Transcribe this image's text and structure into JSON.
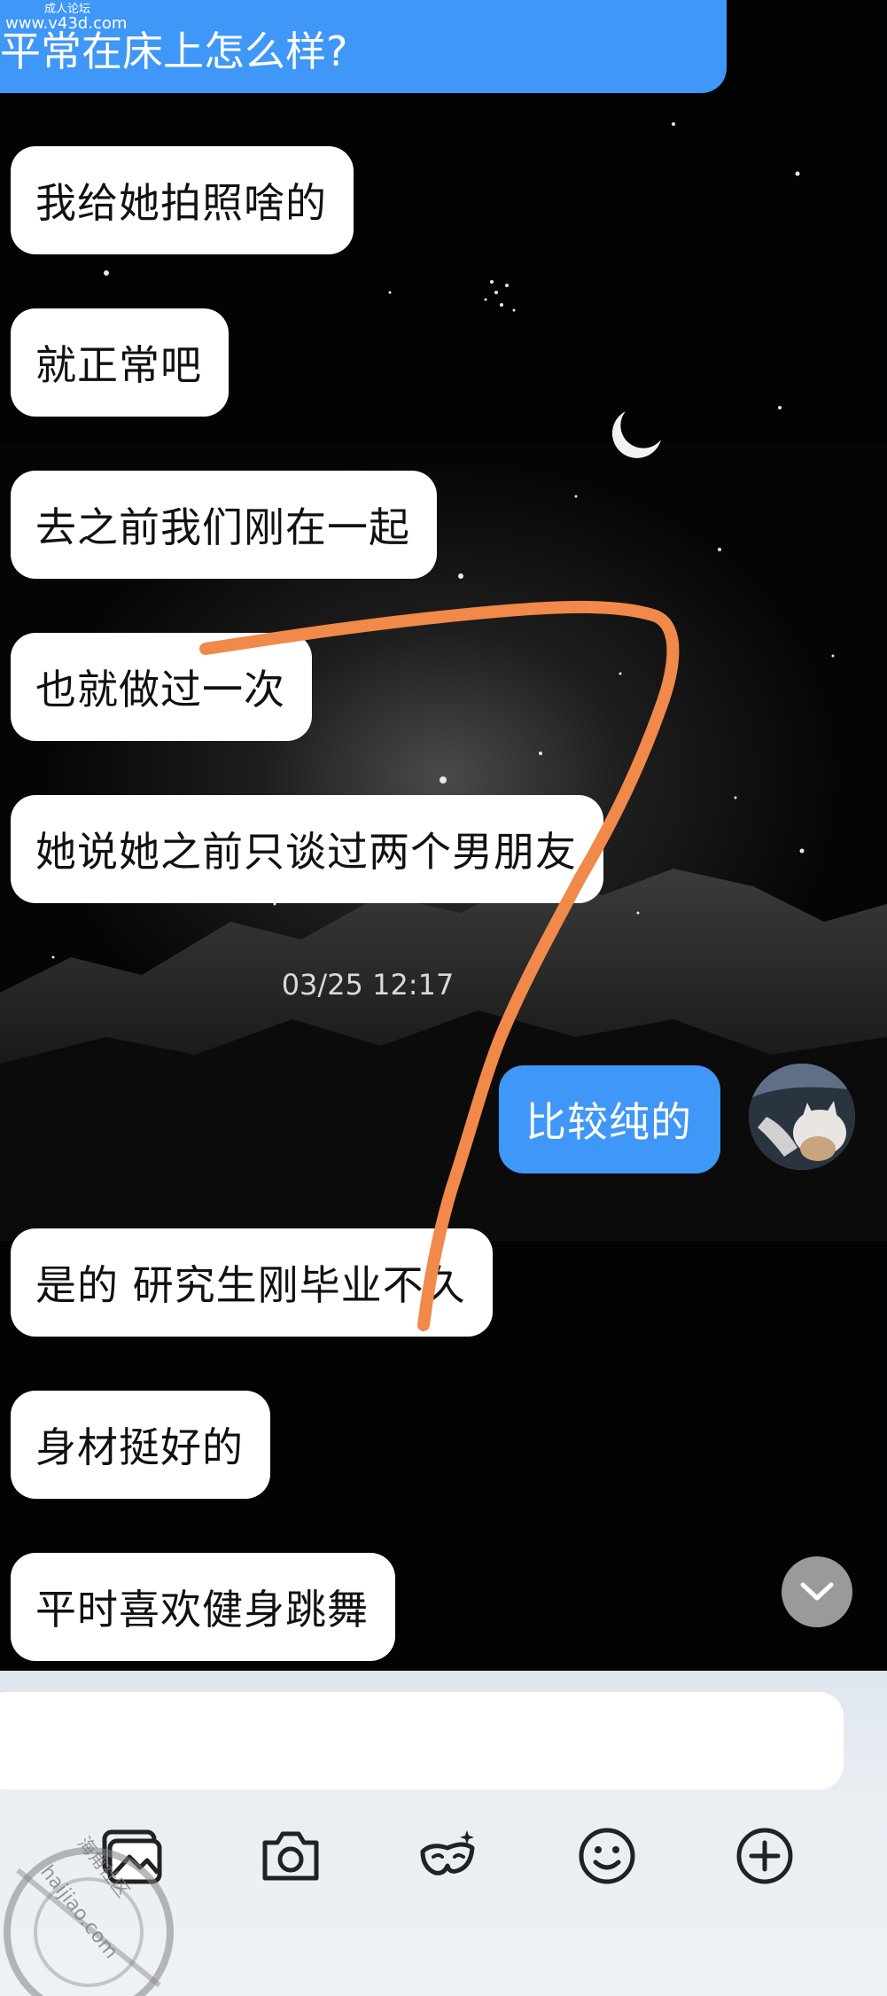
{
  "watermark": {
    "site_cn": "成人论坛",
    "site_url": "www.v43d.com",
    "seal_text": "海角社区",
    "seal_url": "haijiao.com"
  },
  "chat": {
    "top_message": "平常在床上怎么样?",
    "messages_before": [
      "我给她拍照啥的",
      "就正常吧",
      "去之前我们刚在一起",
      "也就做过一次",
      "她说她之前只谈过两个男朋友"
    ],
    "timestamp": "03/25 12:17",
    "outgoing_message": "比较纯的",
    "messages_after": [
      "是的 研究生刚毕业不久",
      "身材挺好的",
      "平时喜欢健身跳舞"
    ]
  },
  "input": {
    "placeholder": ""
  },
  "toolbar": {
    "icons": [
      "image-icon",
      "camera-icon",
      "mask-icon",
      "emoji-icon",
      "plus-icon"
    ]
  },
  "colors": {
    "outgoing_bubble": "#3f97f7",
    "incoming_bubble": "#ffffff",
    "annotation_stroke": "#f0894a"
  }
}
